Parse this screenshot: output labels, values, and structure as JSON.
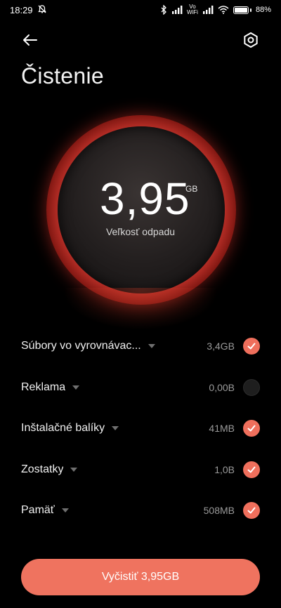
{
  "status_bar": {
    "time": "18:29",
    "alarm_off_icon": "alarm-off-icon",
    "bluetooth_icon": "bluetooth-icon",
    "signal_icon": "signal-icon",
    "vowifi_top": "Vo",
    "vowifi_bottom": "WiFi",
    "wifi_icon": "wifi-icon",
    "battery_percent": "88%",
    "battery_level": 0.88
  },
  "header": {
    "back_icon": "back-arrow-icon",
    "settings_icon": "settings-icon",
    "title": "Čistenie"
  },
  "gauge": {
    "value": "3,95",
    "unit": "GB",
    "label": "Veľkosť odpadu",
    "ring_color": "#c0322a"
  },
  "items": [
    {
      "label": "Súbory vo vyrovnávac...",
      "size": "3,4GB",
      "checked": true
    },
    {
      "label": "Reklama",
      "size": "0,00B",
      "checked": false
    },
    {
      "label": "Inštalačné balíky",
      "size": "41MB",
      "checked": true
    },
    {
      "label": "Zostatky",
      "size": "1,0B",
      "checked": true
    },
    {
      "label": "Pamäť",
      "size": "508MB",
      "checked": true
    }
  ],
  "cta": {
    "label": "Vyčistiť 3,95GB",
    "color": "#ef735f"
  },
  "colors": {
    "accent": "#ef6f5c",
    "background": "#000000"
  }
}
